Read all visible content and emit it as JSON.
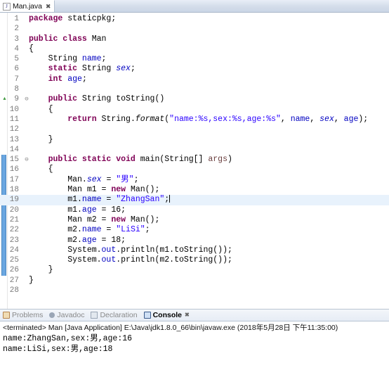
{
  "editor": {
    "tab": {
      "title": "Man.java",
      "file_icon": "java-file-icon",
      "close_label": "✖"
    },
    "lines": [
      {
        "n": 1,
        "fold": "",
        "arrow": false,
        "current": false,
        "changed": false,
        "tokens": [
          {
            "t": "package ",
            "c": "kw"
          },
          {
            "t": "staticpkg;",
            "c": "plain"
          }
        ]
      },
      {
        "n": 2,
        "fold": "",
        "arrow": false,
        "current": false,
        "changed": false,
        "tokens": []
      },
      {
        "n": 3,
        "fold": "",
        "arrow": false,
        "current": false,
        "changed": false,
        "tokens": [
          {
            "t": "public class ",
            "c": "kw"
          },
          {
            "t": "Man",
            "c": "plain"
          }
        ]
      },
      {
        "n": 4,
        "fold": "",
        "arrow": false,
        "current": false,
        "changed": false,
        "tokens": [
          {
            "t": "{",
            "c": "plain"
          }
        ]
      },
      {
        "n": 5,
        "fold": "",
        "arrow": false,
        "current": false,
        "changed": false,
        "tokens": [
          {
            "t": "    String ",
            "c": "plain"
          },
          {
            "t": "name",
            "c": "fld"
          },
          {
            "t": ";",
            "c": "plain"
          }
        ]
      },
      {
        "n": 6,
        "fold": "",
        "arrow": false,
        "current": false,
        "changed": false,
        "tokens": [
          {
            "t": "    static",
            "c": "kw"
          },
          {
            "t": " String ",
            "c": "plain"
          },
          {
            "t": "sex",
            "c": "fldi"
          },
          {
            "t": ";",
            "c": "plain"
          }
        ]
      },
      {
        "n": 7,
        "fold": "",
        "arrow": false,
        "current": false,
        "changed": false,
        "tokens": [
          {
            "t": "    int ",
            "c": "kw"
          },
          {
            "t": "age",
            "c": "fld"
          },
          {
            "t": ";",
            "c": "plain"
          }
        ]
      },
      {
        "n": 8,
        "fold": "",
        "arrow": false,
        "current": false,
        "changed": false,
        "tokens": []
      },
      {
        "n": 9,
        "fold": "⊖",
        "arrow": true,
        "current": false,
        "changed": false,
        "tokens": [
          {
            "t": "    public ",
            "c": "kw"
          },
          {
            "t": "String toString()",
            "c": "plain"
          }
        ]
      },
      {
        "n": 10,
        "fold": "",
        "arrow": false,
        "current": false,
        "changed": false,
        "tokens": [
          {
            "t": "    {",
            "c": "plain"
          }
        ]
      },
      {
        "n": 11,
        "fold": "",
        "arrow": false,
        "current": false,
        "changed": false,
        "tokens": [
          {
            "t": "        return ",
            "c": "kw"
          },
          {
            "t": "String.",
            "c": "plain"
          },
          {
            "t": "format",
            "c": "mth"
          },
          {
            "t": "(",
            "c": "plain"
          },
          {
            "t": "\"name:%s,sex:%s,age:%s\"",
            "c": "str"
          },
          {
            "t": ", ",
            "c": "plain"
          },
          {
            "t": "name",
            "c": "fld"
          },
          {
            "t": ", ",
            "c": "plain"
          },
          {
            "t": "sex",
            "c": "fldi"
          },
          {
            "t": ", ",
            "c": "plain"
          },
          {
            "t": "age",
            "c": "fld"
          },
          {
            "t": ");",
            "c": "plain"
          }
        ]
      },
      {
        "n": 12,
        "fold": "",
        "arrow": false,
        "current": false,
        "changed": false,
        "tokens": []
      },
      {
        "n": 13,
        "fold": "",
        "arrow": false,
        "current": false,
        "changed": false,
        "tokens": [
          {
            "t": "    }",
            "c": "plain"
          }
        ]
      },
      {
        "n": 14,
        "fold": "",
        "arrow": false,
        "current": false,
        "changed": false,
        "tokens": []
      },
      {
        "n": 15,
        "fold": "⊖",
        "arrow": false,
        "current": false,
        "changed": true,
        "tokens": [
          {
            "t": "    public static void ",
            "c": "kw"
          },
          {
            "t": "main(String[] ",
            "c": "plain"
          },
          {
            "t": "args",
            "c": "par"
          },
          {
            "t": ")",
            "c": "plain"
          }
        ]
      },
      {
        "n": 16,
        "fold": "",
        "arrow": false,
        "current": false,
        "changed": true,
        "tokens": [
          {
            "t": "    {",
            "c": "plain"
          }
        ]
      },
      {
        "n": 17,
        "fold": "",
        "arrow": false,
        "current": false,
        "changed": true,
        "tokens": [
          {
            "t": "        Man.",
            "c": "plain"
          },
          {
            "t": "sex",
            "c": "fldi"
          },
          {
            "t": " = ",
            "c": "plain"
          },
          {
            "t": "\"男\"",
            "c": "str"
          },
          {
            "t": ";",
            "c": "plain"
          }
        ]
      },
      {
        "n": 18,
        "fold": "",
        "arrow": false,
        "current": false,
        "changed": true,
        "tokens": [
          {
            "t": "        Man m1 = ",
            "c": "plain"
          },
          {
            "t": "new ",
            "c": "kw"
          },
          {
            "t": "Man();",
            "c": "plain"
          }
        ]
      },
      {
        "n": 19,
        "fold": "",
        "arrow": false,
        "current": true,
        "changed": true,
        "tokens": [
          {
            "t": "        m1.",
            "c": "plain"
          },
          {
            "t": "name",
            "c": "fld"
          },
          {
            "t": " = ",
            "c": "plain"
          },
          {
            "t": "\"ZhangSan\"",
            "c": "str"
          },
          {
            "t": ";",
            "c": "plain"
          }
        ],
        "caret": true
      },
      {
        "n": 20,
        "fold": "",
        "arrow": false,
        "current": false,
        "changed": true,
        "tokens": [
          {
            "t": "        m1.",
            "c": "plain"
          },
          {
            "t": "age",
            "c": "fld"
          },
          {
            "t": " = 16;",
            "c": "plain"
          }
        ]
      },
      {
        "n": 21,
        "fold": "",
        "arrow": false,
        "current": false,
        "changed": true,
        "tokens": [
          {
            "t": "        Man m2 = ",
            "c": "plain"
          },
          {
            "t": "new ",
            "c": "kw"
          },
          {
            "t": "Man();",
            "c": "plain"
          }
        ]
      },
      {
        "n": 22,
        "fold": "",
        "arrow": false,
        "current": false,
        "changed": true,
        "tokens": [
          {
            "t": "        m2.",
            "c": "plain"
          },
          {
            "t": "name",
            "c": "fld"
          },
          {
            "t": " = ",
            "c": "plain"
          },
          {
            "t": "\"LiSi\"",
            "c": "str"
          },
          {
            "t": ";",
            "c": "plain"
          }
        ]
      },
      {
        "n": 23,
        "fold": "",
        "arrow": false,
        "current": false,
        "changed": true,
        "tokens": [
          {
            "t": "        m2.",
            "c": "plain"
          },
          {
            "t": "age",
            "c": "fld"
          },
          {
            "t": " = 18;",
            "c": "plain"
          }
        ]
      },
      {
        "n": 24,
        "fold": "",
        "arrow": false,
        "current": false,
        "changed": true,
        "tokens": [
          {
            "t": "        System.",
            "c": "plain"
          },
          {
            "t": "out",
            "c": "fld"
          },
          {
            "t": ".println(m1.toString());",
            "c": "plain"
          }
        ]
      },
      {
        "n": 25,
        "fold": "",
        "arrow": false,
        "current": false,
        "changed": true,
        "tokens": [
          {
            "t": "        System.",
            "c": "plain"
          },
          {
            "t": "out",
            "c": "fld"
          },
          {
            "t": ".println(m2.toString());",
            "c": "plain"
          }
        ]
      },
      {
        "n": 26,
        "fold": "",
        "arrow": false,
        "current": false,
        "changed": true,
        "tokens": [
          {
            "t": "    }",
            "c": "plain"
          }
        ]
      },
      {
        "n": 27,
        "fold": "",
        "arrow": false,
        "current": false,
        "changed": false,
        "tokens": [
          {
            "t": "}",
            "c": "plain"
          }
        ]
      },
      {
        "n": 28,
        "fold": "",
        "arrow": false,
        "current": false,
        "changed": false,
        "tokens": []
      }
    ]
  },
  "bottom_panel": {
    "tabs": [
      {
        "label": "Problems",
        "icon": "problems-icon",
        "active": false,
        "closable": false
      },
      {
        "label": "Javadoc",
        "icon": "javadoc-icon",
        "active": false,
        "closable": false
      },
      {
        "label": "Declaration",
        "icon": "declaration-icon",
        "active": false,
        "closable": false
      },
      {
        "label": "Console",
        "icon": "console-icon",
        "active": true,
        "closable": true
      }
    ],
    "close_label": "✖",
    "console": {
      "header": "<terminated> Man [Java Application] E:\\Java\\jdk1.8.0_66\\bin\\javaw.exe (2018年5月28日 下午11:35:00)",
      "output": [
        "name:ZhangSan,sex:男,age:16",
        "name:LiSi,sex:男,age:18"
      ]
    }
  },
  "colors": {
    "keyword": "#7f0055",
    "field": "#0000c0",
    "string": "#2a00ff",
    "parameter": "#6a3e3e",
    "current_line": "#e8f2fc",
    "change_bar": "#6aa6e0",
    "tabbar_bg": "#d3dcea"
  }
}
